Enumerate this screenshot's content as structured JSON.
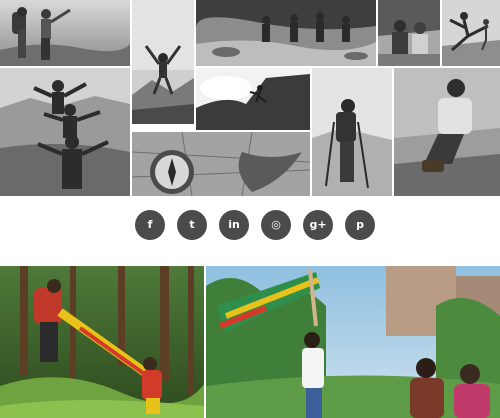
{
  "colors": {
    "page_background": "#ffffff",
    "social_button": "#4b4b4b",
    "social_glyph": "#ffffff"
  },
  "collage_top": {
    "style": "grayscale",
    "tiles": [
      {
        "name": "photo-couple-hikers-arms-raised",
        "icon": "photo-icon"
      },
      {
        "name": "photo-hiker-jumping",
        "icon": "photo-icon"
      },
      {
        "name": "photo-group-river-crossing",
        "icon": "photo-icon"
      },
      {
        "name": "photo-couple-sitting-outdoors",
        "icon": "photo-icon"
      },
      {
        "name": "photo-yoga-pose",
        "icon": "photo-icon"
      },
      {
        "name": "photo-family-mountain-top",
        "icon": "photo-icon"
      },
      {
        "name": "photo-climber-on-rock",
        "icon": "photo-icon"
      },
      {
        "name": "photo-compass-and-map",
        "icon": "compass-icon"
      },
      {
        "name": "photo-hiker-with-poles",
        "icon": "photo-icon"
      },
      {
        "name": "photo-man-tying-boots",
        "icon": "photo-icon"
      }
    ]
  },
  "social": {
    "buttons": [
      {
        "name": "facebook-button",
        "icon": "facebook-icon",
        "glyph": "f"
      },
      {
        "name": "twitter-button",
        "icon": "twitter-icon",
        "glyph": "t"
      },
      {
        "name": "linkedin-button",
        "icon": "linkedin-icon",
        "glyph": "in"
      },
      {
        "name": "dribbble-button",
        "icon": "dribbble-icon",
        "glyph": "◎"
      },
      {
        "name": "google-plus-button",
        "icon": "google-plus-icon",
        "glyph": "g+"
      },
      {
        "name": "pinterest-button",
        "icon": "pinterest-icon",
        "glyph": "p"
      }
    ]
  },
  "collage_bottom": {
    "style": "color",
    "tiles": [
      {
        "name": "photo-forest-hikers-flag",
        "icon": "photo-icon"
      },
      {
        "name": "photo-family-park-flag",
        "icon": "photo-icon"
      }
    ]
  }
}
